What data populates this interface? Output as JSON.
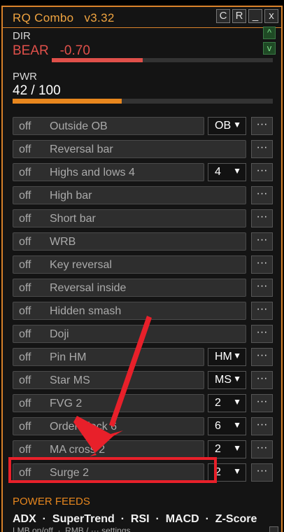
{
  "app": {
    "title": "RQ Combo   v3.32",
    "buttons": [
      "C",
      "R",
      "_",
      "x"
    ]
  },
  "dir": {
    "label": "DIR",
    "direction": "BEAR",
    "value": "-0.70",
    "bar_fraction": 0.41
  },
  "pwr": {
    "label": "PWR",
    "value": "42 / 100",
    "bar_fraction": 0.42
  },
  "side_buttons": [
    "^",
    "v"
  ],
  "rows": [
    {
      "state": "off",
      "name": "Outside OB",
      "select": "OB"
    },
    {
      "state": "off",
      "name": "Reversal bar",
      "select": ""
    },
    {
      "state": "off",
      "name": "Highs and lows 4",
      "select": "4"
    },
    {
      "state": "off",
      "name": "High bar",
      "select": ""
    },
    {
      "state": "off",
      "name": "Short bar",
      "select": ""
    },
    {
      "state": "off",
      "name": "WRB",
      "select": ""
    },
    {
      "state": "off",
      "name": "Key reversal",
      "select": ""
    },
    {
      "state": "off",
      "name": "Reversal inside",
      "select": ""
    },
    {
      "state": "off",
      "name": "Hidden smash",
      "select": ""
    },
    {
      "state": "off",
      "name": "Doji",
      "select": ""
    },
    {
      "state": "off",
      "name": "Pin HM",
      "select": "HM"
    },
    {
      "state": "off",
      "name": "Star MS",
      "select": "MS"
    },
    {
      "state": "off",
      "name": "FVG 2",
      "select": "2"
    },
    {
      "state": "off",
      "name": "Order block 6",
      "select": "6"
    },
    {
      "state": "off",
      "name": "MA cross 2",
      "select": "2"
    },
    {
      "state": "off",
      "name": "Surge 2",
      "select": "2"
    }
  ],
  "dots_label": "···",
  "select_arrow": "▼",
  "feeds": {
    "title": "POWER FEEDS",
    "list": "ADX  ·  SuperTrend  ·  RSI  ·  MACD  ·  Z-Score",
    "hint": "LMB on/off  ·  RMB / ··· settings"
  },
  "colors": {
    "accent": "#d9822b",
    "bear": "#e0504a",
    "power": "#e8871e",
    "annotation": "#e8202a"
  }
}
